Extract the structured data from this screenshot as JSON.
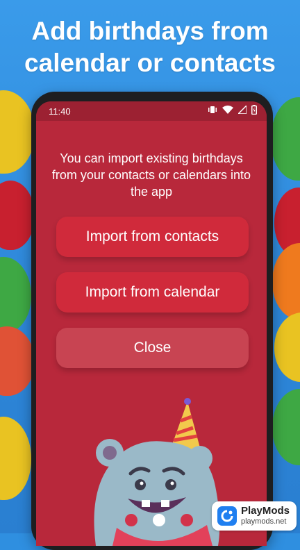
{
  "headline": {
    "line1": "Add birthdays from",
    "line2": "calendar or contacts"
  },
  "status_bar": {
    "time": "11:40",
    "icons": [
      "vibrate-icon",
      "wifi-icon",
      "signal-icon",
      "battery-charging-icon"
    ]
  },
  "dialog": {
    "message": "You can import existing birthdays from your contacts or calendars into the app",
    "buttons": {
      "import_contacts": "Import from contacts",
      "import_calendar": "Import from calendar",
      "close": "Close"
    }
  },
  "watermark": {
    "title": "PlayMods",
    "url": "playmods.net"
  },
  "colors": {
    "background": "#2f8fe0",
    "screen": "#b8283b",
    "button_primary": "#d02a3b",
    "button_close": "#c84452",
    "mascot": "#9ab9c8",
    "party_hat": "#f2c94c"
  }
}
